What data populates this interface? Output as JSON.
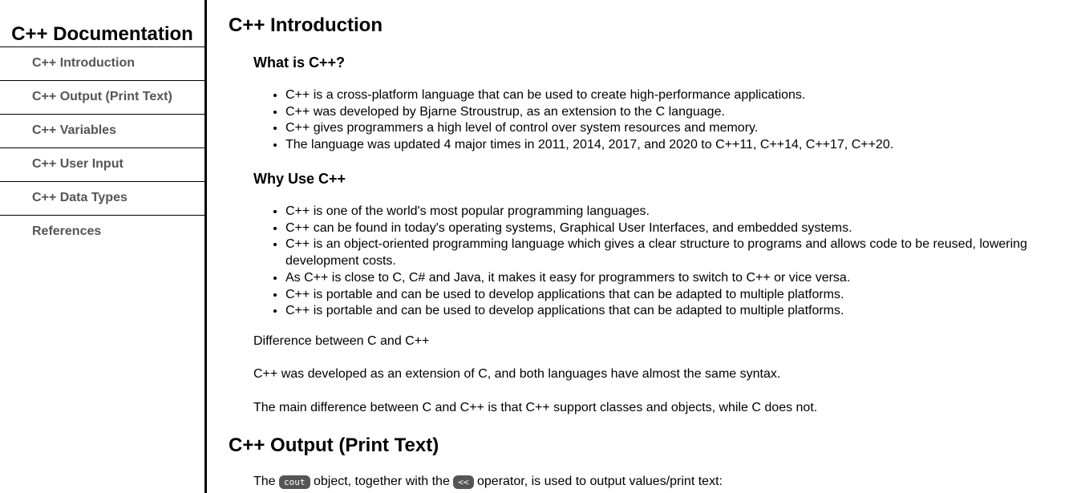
{
  "sidebar": {
    "title": "C++ Documentation",
    "items": [
      {
        "label": "C++ Introduction"
      },
      {
        "label": "C++ Output (Print Text)"
      },
      {
        "label": "C++ Variables"
      },
      {
        "label": "C++ User Input"
      },
      {
        "label": "C++ Data Types"
      },
      {
        "label": "References"
      }
    ]
  },
  "main": {
    "intro": {
      "title": "C++ Introduction",
      "what_heading": "What is C++?",
      "what_items": [
        "C++ is a cross-platform language that can be used to create high-performance applications.",
        "C++ was developed by Bjarne Stroustrup, as an extension to the C language.",
        "C++ gives programmers a high level of control over system resources and memory.",
        "The language was updated 4 major times in 2011, 2014, 2017, and 2020 to C++11, C++14, C++17, C++20."
      ],
      "why_heading": "Why Use C++",
      "why_items": [
        "C++ is one of the world's most popular programming languages.",
        "C++ can be found in today's operating systems, Graphical User Interfaces, and embedded systems.",
        "C++ is an object-oriented programming language which gives a clear structure to programs and allows code to be reused, lowering development costs.",
        "As C++ is close to C, C# and Java, it makes it easy for programmers to switch to C++ or vice versa.",
        "C++ is portable and can be used to develop applications that can be adapted to multiple platforms.",
        "C++ is portable and can be used to develop applications that can be adapted to multiple platforms."
      ],
      "difference_heading": "Difference between C and C++",
      "difference_p1": "C++ was developed as an extension of C, and both languages have almost the same syntax.",
      "difference_p2": "The main difference between C and C++ is that C++ support classes and objects, while C does not."
    },
    "output": {
      "title": "C++ Output (Print Text)",
      "text_before": "The ",
      "code_cout": "cout",
      "text_middle": " object, together with the ",
      "code_op": "<<",
      "text_after": " operator, is used to output values/print text:"
    }
  }
}
